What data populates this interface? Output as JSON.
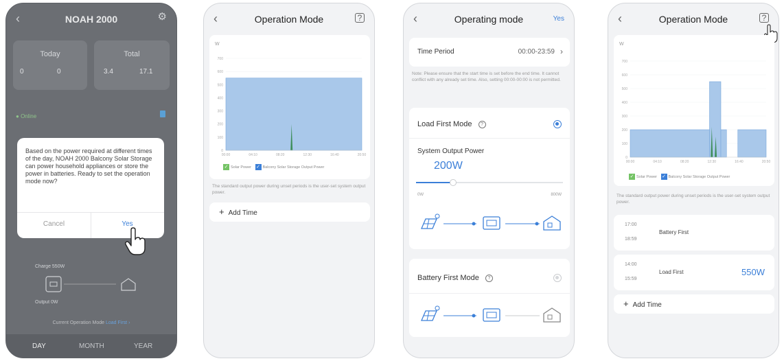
{
  "phone1": {
    "title": "NOAH 2000",
    "today_label": "Today",
    "total_label": "Total",
    "today_values": [
      "0",
      "0"
    ],
    "total_values": [
      "3.4",
      "17.1"
    ],
    "status": "Online",
    "dialog_message": "Based on the power required at different times of the day, NOAH 2000 Balcony Solar Storage can power household appliances or store the power in batteries. Ready to set the operation mode now?",
    "cancel_label": "Cancel",
    "yes_label": "Yes",
    "charge_text": "Charge 550W",
    "output_text": "Output 0W",
    "current_mode_text": "Current Operation Mode",
    "current_mode_value": "Load First",
    "tabs": [
      "DAY",
      "MONTH",
      "YEAR"
    ]
  },
  "phone2": {
    "title": "Operation Mode",
    "chart_unit": "W",
    "legend": [
      "Solar Power",
      "Balcony Solar Storage Output Power"
    ],
    "note": "The standard output power during unset periods is the user-set system output power.",
    "add_time": "Add Time"
  },
  "phone3": {
    "title": "Operating mode",
    "yes_label": "Yes",
    "time_period_label": "Time Period",
    "time_period_value": "00:00-23:59",
    "note": "Note: Please ensure that the start time is set before the end time. It cannot conflict with any already set time. Also, setting 00:00-00:00 is not permitted.",
    "load_first_label": "Load First Mode",
    "system_output_label": "System Output Power",
    "system_output_value": "200W",
    "slider_min": "0W",
    "slider_max": "800W",
    "slider_fraction": 0.25,
    "battery_first_label": "Battery First Mode"
  },
  "phone4": {
    "title": "Operation Mode",
    "chart_unit": "W",
    "legend": [
      "Solar Power",
      "Balcony Solar Storage Output Power"
    ],
    "note": "The standard output power during unset periods is the user-set system output power.",
    "periods": [
      {
        "start": "17:00",
        "end": "18:59",
        "mode": "Battery First",
        "power": ""
      },
      {
        "start": "14:00",
        "end": "15:59",
        "mode": "Load First",
        "power": "550W"
      }
    ],
    "add_time": "Add Time"
  },
  "colors": {
    "accent": "#3b7fd8",
    "chart_fill": "#a9c8ea",
    "chart_line": "#7aa8dc",
    "solar_green": "#74c365"
  },
  "chart_data": [
    {
      "type": "area",
      "ylabel": "W",
      "yticks": [
        "700",
        "600",
        "500",
        "400",
        "300",
        "200",
        "100",
        "0"
      ],
      "x": [
        "00:00",
        "04:10",
        "08:20",
        "12:30",
        "16:40",
        "20:50"
      ],
      "ylim": [
        0,
        700
      ],
      "series": [
        {
          "name": "Balcony Solar Storage Output Power",
          "segments": [
            {
              "x0": 0,
              "x1": 24,
              "y": 550
            }
          ]
        },
        {
          "name": "Solar Power",
          "spikes": [
            {
              "x": 11.6,
              "y": 200
            }
          ]
        }
      ]
    },
    {
      "type": "area",
      "ylabel": "W",
      "yticks": [
        "700",
        "600",
        "500",
        "400",
        "300",
        "200",
        "100",
        "0"
      ],
      "x": [
        "00:00",
        "04:10",
        "08:20",
        "12:30",
        "16:40",
        "20:50"
      ],
      "ylim": [
        0,
        700
      ],
      "series": [
        {
          "name": "Balcony Solar Storage Output Power",
          "segments": [
            {
              "x0": 0,
              "x1": 14,
              "y": 200
            },
            {
              "x0": 14,
              "x1": 16,
              "y": 550
            },
            {
              "x0": 16,
              "x1": 17,
              "y": 200
            },
            {
              "x0": 19,
              "x1": 24,
              "y": 200
            }
          ]
        },
        {
          "name": "Solar Power",
          "spikes": [
            {
              "x": 14.4,
              "y": 220
            },
            {
              "x": 15.1,
              "y": 150
            }
          ]
        }
      ]
    }
  ]
}
